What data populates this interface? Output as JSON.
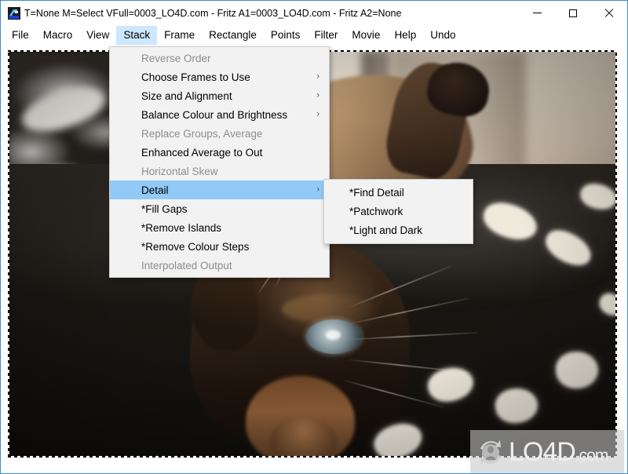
{
  "window": {
    "title": "T=None M=Select VFull=0003_LO4D.com - Fritz A1=0003_LO4D.com - Fritz A2=None",
    "app_icon": "fritz-app-icon",
    "controls": {
      "minimize": "minimize-icon",
      "maximize": "maximize-icon",
      "close": "close-icon"
    },
    "border_color": "#3d8fd1"
  },
  "menubar": {
    "items": [
      {
        "label": "File",
        "active": false
      },
      {
        "label": "Macro",
        "active": false
      },
      {
        "label": "View",
        "active": false
      },
      {
        "label": "Stack",
        "active": true
      },
      {
        "label": "Frame",
        "active": false
      },
      {
        "label": "Rectangle",
        "active": false
      },
      {
        "label": "Points",
        "active": false
      },
      {
        "label": "Filter",
        "active": false
      },
      {
        "label": "Movie",
        "active": false
      },
      {
        "label": "Help",
        "active": false
      },
      {
        "label": "Undo",
        "active": false
      }
    ],
    "active_highlight_color": "#cce8ff"
  },
  "stack_menu": {
    "selected_highlight_color": "#91c9f7",
    "background_color": "#f2f2f2",
    "items": [
      {
        "label": "Reverse Order",
        "enabled": false,
        "submenu": false,
        "selected": false
      },
      {
        "label": "Choose Frames to Use",
        "enabled": true,
        "submenu": true,
        "selected": false
      },
      {
        "label": "Size and Alignment",
        "enabled": true,
        "submenu": true,
        "selected": false
      },
      {
        "label": "Balance Colour and Brightness",
        "enabled": true,
        "submenu": true,
        "selected": false
      },
      {
        "label": "Replace Groups, Average",
        "enabled": false,
        "submenu": false,
        "selected": false
      },
      {
        "label": "Enhanced Average to Out",
        "enabled": true,
        "submenu": false,
        "selected": false
      },
      {
        "label": "Horizontal Skew",
        "enabled": false,
        "submenu": false,
        "selected": false
      },
      {
        "label": "Detail",
        "enabled": true,
        "submenu": true,
        "selected": true
      },
      {
        "label": "*Fill Gaps",
        "enabled": true,
        "submenu": false,
        "selected": false
      },
      {
        "label": "*Remove Islands",
        "enabled": true,
        "submenu": false,
        "selected": false
      },
      {
        "label": "*Remove Colour Steps",
        "enabled": true,
        "submenu": false,
        "selected": false
      },
      {
        "label": "Interpolated Output",
        "enabled": false,
        "submenu": false,
        "selected": false
      }
    ],
    "submenu_arrow": "›"
  },
  "detail_submenu": {
    "parent": "Detail",
    "items": [
      {
        "label": "*Find Detail",
        "enabled": true,
        "selected": false
      },
      {
        "label": "*Patchwork",
        "enabled": true,
        "selected": false
      },
      {
        "label": "*Light and Dark",
        "enabled": true,
        "selected": false
      }
    ]
  },
  "canvas": {
    "selection": "dashed-marching-ants-border",
    "image_description": "photograph of a siamese-type cat lying upside down on a dark fleece blanket with white paw-print spots"
  },
  "watermark": {
    "text": "LO4D",
    "suffix": ".com",
    "logo": "circular-arrows-logo"
  }
}
